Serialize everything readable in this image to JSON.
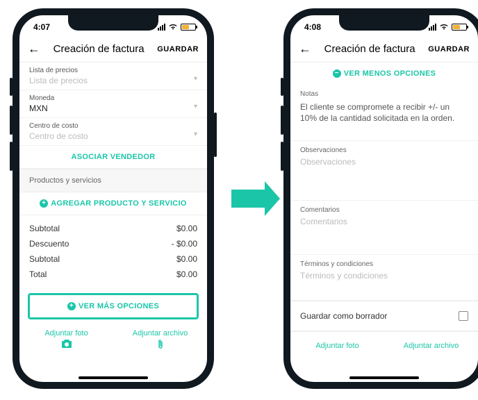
{
  "left": {
    "time": "4:07",
    "appbar": {
      "title": "Creación de factura",
      "save": "GUARDAR"
    },
    "fields": {
      "price_list": {
        "label": "Lista de precios",
        "value": "Lista de precios"
      },
      "currency": {
        "label": "Moneda",
        "value": "MXN"
      },
      "cost_center": {
        "label": "Centro de costo",
        "value": "Centro de costo"
      }
    },
    "associate_seller": "ASOCIAR VENDEDOR",
    "products_header": "Productos y servicios",
    "add_product": "AGREGAR PRODUCTO Y SERVICIO",
    "totals": {
      "subtotal_label": "Subtotal",
      "subtotal_val": "$0.00",
      "discount_label": "Descuento",
      "discount_val": "- $0.00",
      "subtotal2_label": "Subtotal",
      "subtotal2_val": "$0.00",
      "total_label": "Total",
      "total_val": "$0.00"
    },
    "more_options": "VER MÁS OPCIONES",
    "attach_photo": "Adjuntar foto",
    "attach_file": "Adjuntar archivo"
  },
  "right": {
    "time": "4:08",
    "appbar": {
      "title": "Creación de factura",
      "save": "GUARDAR"
    },
    "less_options": "VER MENOS OPCIONES",
    "notes": {
      "label": "Notas",
      "text": "El cliente se compromete a recibir +/- un 10% de la cantidad solicitada en la orden."
    },
    "obs": {
      "label": "Observaciones",
      "placeholder": "Observaciones"
    },
    "comm": {
      "label": "Comentarios",
      "placeholder": "Comentarios"
    },
    "terms": {
      "label": "Términos y condiciones",
      "placeholder": "Términos y condiciones"
    },
    "draft_label": "Guardar como borrador",
    "attach_photo": "Adjuntar foto",
    "attach_file": "Adjuntar archivo"
  }
}
